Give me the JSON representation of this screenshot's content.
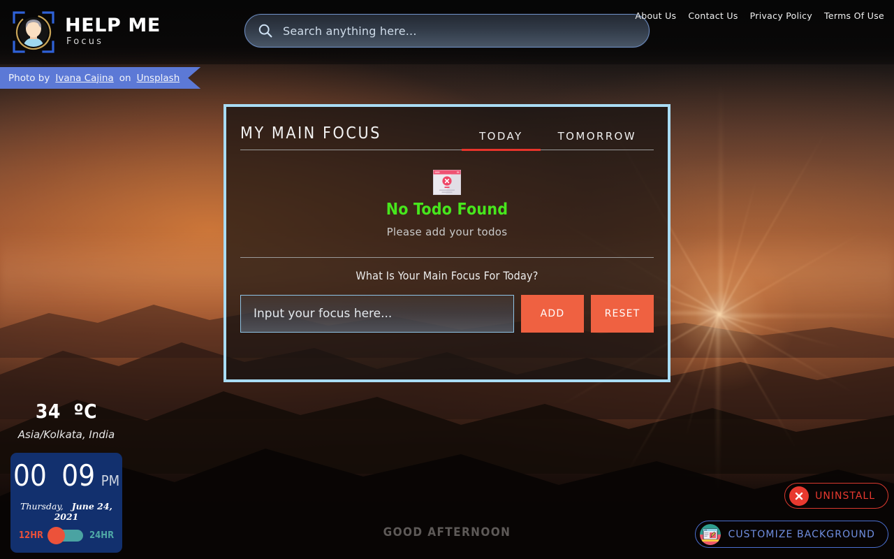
{
  "brand": {
    "title": "HELP ME",
    "subtitle": "Focus",
    "logo_icon": "person-focus-frame-icon"
  },
  "search": {
    "icon": "search-icon",
    "placeholder": "Search anything here...",
    "value": ""
  },
  "nav": {
    "links": [
      {
        "label": "About Us"
      },
      {
        "label": "Contact Us"
      },
      {
        "label": "Privacy Policy"
      },
      {
        "label": "Terms Of Use"
      }
    ]
  },
  "credit": {
    "prefix": "Photo by",
    "author": "Ivana Cajina",
    "middle": "on",
    "source": "Unsplash",
    "background_color": "#5c79d6"
  },
  "focus_card": {
    "title": "MY MAIN FOCUS",
    "border_color": "#a9dcf4",
    "tabs": [
      {
        "label": "TODAY",
        "active": true
      },
      {
        "label": "TOMORROW",
        "active": false
      }
    ],
    "active_tab_color": "#e8342b",
    "empty_state": {
      "icon": "no-todo-window-error-icon",
      "title": "No Todo Found",
      "title_color": "#47e61d",
      "subtitle": "Please add your todos"
    },
    "prompt": "What Is Your Main Focus For Today?",
    "input": {
      "placeholder": "Input your focus here...",
      "value": ""
    },
    "add_label": "ADD",
    "reset_label": "RESET",
    "button_color": "#ef6141"
  },
  "weather": {
    "temperature": "34",
    "unit": "ºC",
    "location": "Asia/Kolkata, India"
  },
  "clock": {
    "hours": "00",
    "minutes": "09",
    "meridiem": "PM",
    "weekday": "Thursday,",
    "date": "June 24, 2021",
    "format_left_label": "12HR",
    "format_right_label": "24HR",
    "active_format": "12HR",
    "background_color": "#12306e",
    "knob_color": "#ec523a",
    "track_color": "#4aa3a2"
  },
  "greeting": "GOOD AFTERNOON",
  "uninstall": {
    "icon": "close-circle-icon",
    "label": "UNINSTALL",
    "color": "#e8392f"
  },
  "customize": {
    "icon": "customize-background-icon",
    "label": "CUSTOMIZE BACKGROUND",
    "color": "#6f8ee0"
  }
}
